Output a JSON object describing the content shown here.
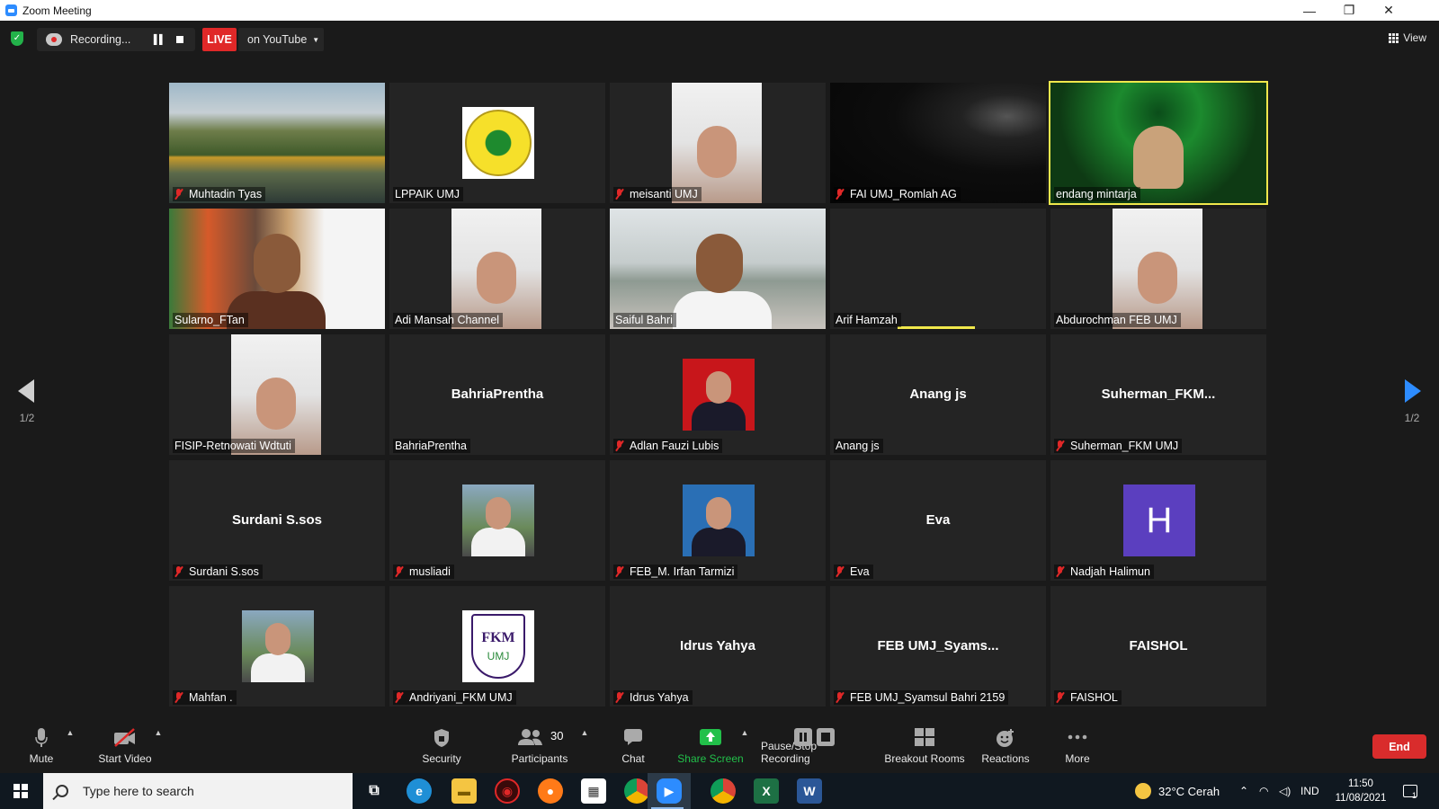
{
  "window": {
    "title": "Zoom Meeting",
    "minimize": "—",
    "restore": "❐",
    "close": "✕"
  },
  "topbar": {
    "recording_label": "Recording...",
    "live_label": "LIVE",
    "live_platform": "on YouTube",
    "view_label": "View"
  },
  "pager": {
    "left_page": "1/2",
    "right_page": "1/2"
  },
  "tiles": [
    {
      "name": "Muhtadin Tyas",
      "muted": true,
      "kind": "video-landscape"
    },
    {
      "name": "LPPAIK UMJ",
      "muted": false,
      "kind": "logo-umj"
    },
    {
      "name": "meisanti UMJ",
      "muted": true,
      "kind": "video-portrait"
    },
    {
      "name": "FAI UMJ_Romlah AG",
      "muted": true,
      "kind": "video-dark"
    },
    {
      "name": "endang mintarja",
      "muted": false,
      "kind": "video-banner",
      "active": true
    },
    {
      "name": "Sularno_FTan",
      "muted": false,
      "kind": "video-speaker"
    },
    {
      "name": "Adi Mansah Channel",
      "muted": false,
      "kind": "video-portrait"
    },
    {
      "name": "Saiful Bahri",
      "muted": false,
      "kind": "video-building"
    },
    {
      "name": "Arif Hamzah",
      "muted": false,
      "kind": "blank"
    },
    {
      "name": "Abdurochman FEB UMJ",
      "muted": false,
      "kind": "video-portrait"
    },
    {
      "name": "FISIP-Retnowati Wdtuti",
      "muted": false,
      "kind": "video-portrait"
    },
    {
      "name": "BahriaPrentha",
      "muted": false,
      "kind": "name",
      "display": "BahriaPrentha"
    },
    {
      "name": "Adlan Fauzi Lubis",
      "muted": true,
      "kind": "photo-red"
    },
    {
      "name": "Anang js",
      "muted": false,
      "kind": "name",
      "display": "Anang js"
    },
    {
      "name": "Suherman_FKM UMJ",
      "muted": true,
      "kind": "name",
      "display": "Suherman_FKM..."
    },
    {
      "name": "Surdani S.sos",
      "muted": true,
      "kind": "name",
      "display": "Surdani S.sos"
    },
    {
      "name": "musliadi",
      "muted": true,
      "kind": "photo-outdoor"
    },
    {
      "name": "FEB_M. Irfan Tarmizi",
      "muted": true,
      "kind": "photo-blue"
    },
    {
      "name": "Eva",
      "muted": true,
      "kind": "name",
      "display": "Eva"
    },
    {
      "name": "Nadjah Halimun",
      "muted": true,
      "kind": "avatar",
      "display": "H"
    },
    {
      "name": "Mahfan .",
      "muted": true,
      "kind": "photo-outdoor"
    },
    {
      "name": "Andriyani_FKM UMJ",
      "muted": true,
      "kind": "logo-fkm",
      "logo_text": "FKM",
      "logo_sub": "UMJ"
    },
    {
      "name": "Idrus Yahya",
      "muted": true,
      "kind": "name",
      "display": "Idrus Yahya"
    },
    {
      "name": "FEB UMJ_Syamsul Bahri 2159",
      "muted": true,
      "kind": "name",
      "display": "FEB  UMJ_Syams..."
    },
    {
      "name": "FAISHOL",
      "muted": true,
      "kind": "name",
      "display": "FAISHOL"
    }
  ],
  "controls": {
    "mute": "Mute",
    "start_video": "Start Video",
    "security": "Security",
    "participants": "Participants",
    "participants_count": "30",
    "chat": "Chat",
    "share_screen": "Share Screen",
    "pause_recording": "Pause/Stop Recording",
    "breakout_rooms": "Breakout Rooms",
    "reactions": "Reactions",
    "more": "More",
    "end": "End"
  },
  "taskbar": {
    "search_placeholder": "Type here to search",
    "weather": "32°C  Cerah",
    "language": "IND",
    "time": "11:50",
    "date": "11/08/2021",
    "notifications": "1"
  },
  "colors": {
    "accent_blue": "#2d8cff",
    "live_red": "#e02828",
    "share_green": "#22c04a",
    "active_speaker": "#f0e84c",
    "avatar_purple": "#5b3fbf"
  }
}
